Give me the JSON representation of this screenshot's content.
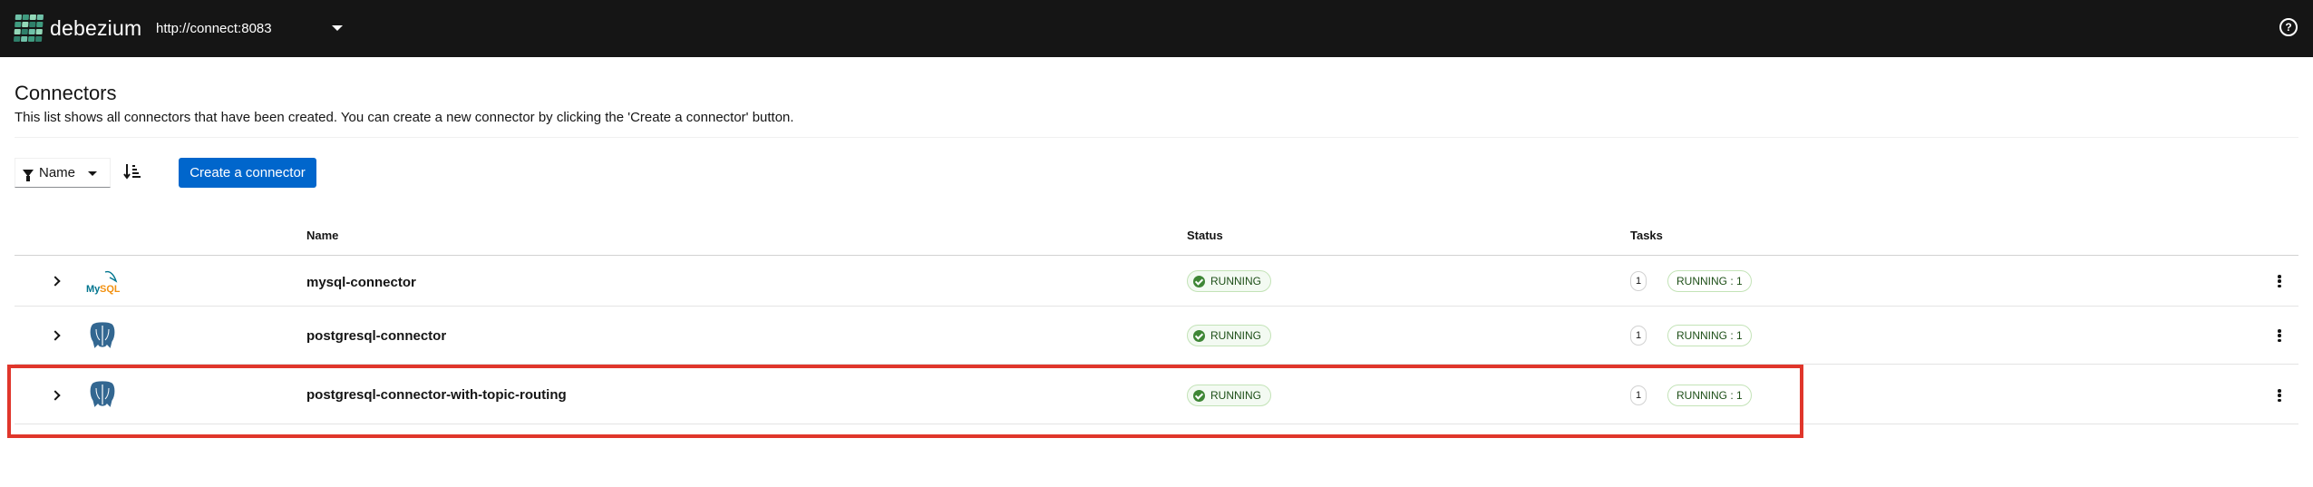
{
  "topbar": {
    "brand": "debezium",
    "cluster_url": "http://connect:8083",
    "help_icon": "help-circle-icon",
    "logo_colors": [
      "#6fc1a8",
      "#3f9b7f",
      "#93d8b8",
      "#2f7f6a"
    ]
  },
  "header": {
    "title": "Connectors",
    "description": "This list shows all connectors that have been created. You can create a new connector by clicking the 'Create a connector' button."
  },
  "toolbar": {
    "filter_label": "Name",
    "filter_icon": "filter-icon",
    "sort_icon": "sort-amount-down-icon",
    "create_label": "Create a connector"
  },
  "table": {
    "columns": [
      "Name",
      "Status",
      "Tasks"
    ],
    "rows": [
      {
        "logo": "mysql-logo",
        "name": "mysql-connector",
        "status": "RUNNING",
        "task_count": "1",
        "task_status": "RUNNING : 1"
      },
      {
        "logo": "postgresql-logo",
        "name": "postgresql-connector",
        "status": "RUNNING",
        "task_count": "1",
        "task_status": "RUNNING : 1"
      },
      {
        "logo": "postgresql-logo",
        "name": "postgresql-connector-with-topic-routing",
        "status": "RUNNING",
        "task_count": "1",
        "task_status": "RUNNING : 1",
        "highlighted": true
      }
    ]
  },
  "colors": {
    "topbar_bg": "#151515",
    "primary_button": "#0066cc",
    "running_green": "#3e8635",
    "highlight_red": "#e0362b",
    "postgres_blue": "#336791"
  }
}
